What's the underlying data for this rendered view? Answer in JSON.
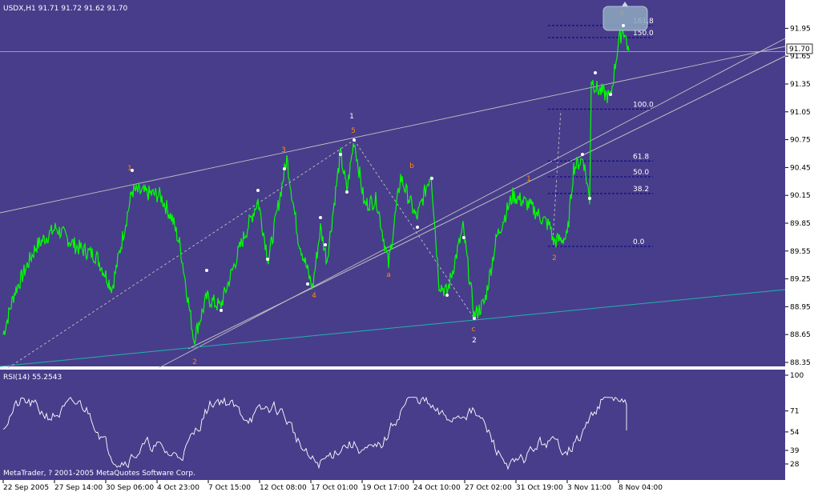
{
  "window": {
    "symbol_header": "USDX,H1  91.71 91.72 91.62 91.70",
    "rsi_header": "RSI(14) 55.2543",
    "copyright": "MetaTrader, ? 2001-2005 MetaQuotes Software Corp."
  },
  "colors": {
    "background": "#483D8B",
    "price": "#00FF00",
    "trend_lines": "#C0C0C0",
    "lower_channel": "#20B2AA",
    "fib_levels": "#000080",
    "wave_labels_primary": "#FF8C00",
    "wave_labels_major": "#FFFFFF",
    "rsi_line": "#FFFFFF",
    "axis_text": "#000000",
    "price_marker_bg": "#FFFFFF"
  },
  "chart_data": [
    {
      "type": "line",
      "title": "USDX,H1",
      "ohlc": {
        "open": 91.71,
        "high": 91.72,
        "low": 91.62,
        "close": 91.7
      },
      "ylim": [
        88.35,
        92.1
      ],
      "y_ticks": [
        "91.95",
        "91.65",
        "91.35",
        "91.05",
        "90.75",
        "90.45",
        "90.15",
        "89.85",
        "89.55",
        "89.25",
        "88.95",
        "88.65",
        "88.35"
      ],
      "x_ticks": [
        "22 Sep 2005",
        "27 Sep 14:00",
        "30 Sep 06:00",
        "4 Oct 23:00",
        "7 Oct 15:00",
        "12 Oct 08:00",
        "17 Oct 01:00",
        "19 Oct 17:00",
        "24 Oct 10:00",
        "27 Oct 02:00",
        "31 Oct 19:00",
        "3 Nov 11:00",
        "8 Nov 04:00"
      ],
      "current_price": "91.70",
      "key_points": [
        {
          "label": "1",
          "time": "27 Sep",
          "value": 90.25
        },
        {
          "label": "2",
          "time": "4 Oct",
          "value": 88.6
        },
        {
          "label": "3",
          "time": "12 Oct",
          "value": 90.6
        },
        {
          "label": "4",
          "time": "14 Oct",
          "value": 89.15
        },
        {
          "label": "5",
          "time": "18 Oct",
          "value": 90.75
        },
        {
          "label": "a",
          "time": "21 Oct",
          "value": 89.4
        },
        {
          "label": "b",
          "time": "24 Oct",
          "value": 90.4
        },
        {
          "label": "c",
          "time": "27 Oct",
          "value": 88.85
        },
        {
          "label": "1",
          "time": "31 Oct",
          "value": 90.2
        },
        {
          "label": "2",
          "time": "1 Nov",
          "value": 89.6
        },
        {
          "label": "3",
          "time": "8 Nov",
          "value": 92.0
        }
      ],
      "wave_labels": [
        {
          "text": "1",
          "color": "orange"
        },
        {
          "text": "2",
          "color": "orange"
        },
        {
          "text": "3",
          "color": "orange"
        },
        {
          "text": "4",
          "color": "orange"
        },
        {
          "text": "5",
          "color": "orange"
        },
        {
          "text": "1",
          "color": "white"
        },
        {
          "text": "a",
          "color": "orange"
        },
        {
          "text": "b",
          "color": "orange"
        },
        {
          "text": "c",
          "color": "orange"
        },
        {
          "text": "2",
          "color": "white"
        },
        {
          "text": "1",
          "color": "orange"
        },
        {
          "text": "2",
          "color": "orange"
        },
        {
          "text": "3",
          "color": "orange"
        }
      ],
      "fib_levels": [
        {
          "label": "161.8",
          "value": 91.98
        },
        {
          "label": "150.0",
          "value": 91.85
        },
        {
          "label": "100.0",
          "value": 91.08
        },
        {
          "label": "61.8",
          "value": 90.52
        },
        {
          "label": "50.0",
          "value": 90.35
        },
        {
          "label": "38.2",
          "value": 90.17
        },
        {
          "label": "0.0",
          "value": 89.6
        }
      ]
    },
    {
      "type": "line",
      "title": "RSI(14)",
      "value": 55.2543,
      "ylim": [
        15,
        100
      ],
      "y_ticks": [
        "100",
        "71",
        "54",
        "39",
        "28"
      ]
    }
  ]
}
